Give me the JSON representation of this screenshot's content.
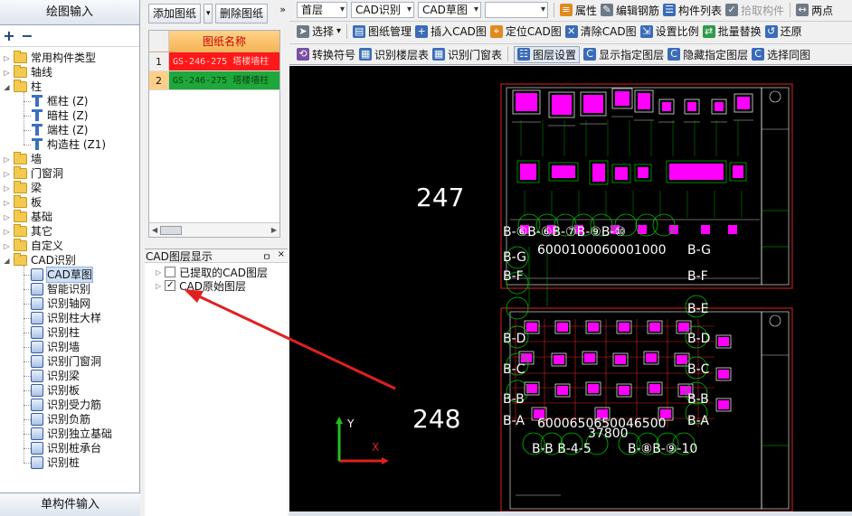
{
  "left": {
    "title": "绘图输入",
    "bottom_title": "单构件输入",
    "tree": [
      {
        "label": "常用构件类型",
        "icon": "folder-icon"
      },
      {
        "label": "轴线",
        "icon": "folder-icon"
      },
      {
        "label": "柱",
        "icon": "folder-icon"
      },
      {
        "label": "框柱 (Z)",
        "icon": "column-icon"
      },
      {
        "label": "暗柱 (Z)",
        "icon": "column-icon"
      },
      {
        "label": "端柱 (Z)",
        "icon": "column-icon"
      },
      {
        "label": "构造柱 (Z1)",
        "icon": "column-icon"
      },
      {
        "label": "墙",
        "icon": "folder-icon"
      },
      {
        "label": "门窗洞",
        "icon": "folder-icon"
      },
      {
        "label": "梁",
        "icon": "folder-icon"
      },
      {
        "label": "板",
        "icon": "folder-icon"
      },
      {
        "label": "基础",
        "icon": "folder-icon"
      },
      {
        "label": "其它",
        "icon": "folder-icon"
      },
      {
        "label": "自定义",
        "icon": "folder-icon"
      },
      {
        "label": "CAD识别",
        "icon": "folder-icon"
      },
      {
        "label": "CAD草图",
        "icon": "cad-sketch-icon"
      },
      {
        "label": "智能识别",
        "icon": "smart-recognize-icon"
      },
      {
        "label": "识别轴网",
        "icon": "recognize-icon"
      },
      {
        "label": "识别柱大样",
        "icon": "recognize-icon"
      },
      {
        "label": "识别柱",
        "icon": "recognize-icon"
      },
      {
        "label": "识别墙",
        "icon": "recognize-icon"
      },
      {
        "label": "识别门窗洞",
        "icon": "recognize-icon"
      },
      {
        "label": "识别梁",
        "icon": "recognize-icon"
      },
      {
        "label": "识别板",
        "icon": "recognize-icon"
      },
      {
        "label": "识别受力筋",
        "icon": "recognize-icon"
      },
      {
        "label": "识别负筋",
        "icon": "recognize-icon"
      },
      {
        "label": "识别独立基础",
        "icon": "recognize-icon"
      },
      {
        "label": "识别桩承台",
        "icon": "recognize-icon"
      },
      {
        "label": "识别桩",
        "icon": "recognize-icon"
      }
    ]
  },
  "drawings": {
    "add_label": "添加图纸",
    "delete_label": "删除图纸",
    "more_label": "»",
    "column_header": "图纸名称",
    "rows": [
      {
        "num": "1",
        "name": "GS-246-275 塔楼墙柱",
        "color": "#ff1818"
      },
      {
        "num": "2",
        "name": "GS-246-275 塔楼墙柱",
        "color": "#1ea83a"
      }
    ]
  },
  "layers": {
    "title": "CAD图层显示",
    "pin_label": "ㅁ",
    "close_label": "×",
    "items": [
      {
        "label": "已提取的CAD图层",
        "checked": "",
        "expand": "▷"
      },
      {
        "label": "CAD原始图层",
        "checked": "✓",
        "expand": "▷"
      }
    ]
  },
  "toolbar": {
    "floor": "首层",
    "mode": "CAD识别",
    "sub_mode": "CAD草图",
    "empty_combo": "",
    "properties": "属性",
    "edit_rebar": "编辑钢筋",
    "component_list": "构件列表",
    "pick_component": "拾取构件",
    "two_points": "两点",
    "select": "选择",
    "drawing_manage": "图纸管理",
    "insert_cad": "插入CAD图",
    "locate_cad": "定位CAD图",
    "clear_cad": "清除CAD图",
    "set_scale": "设置比例",
    "batch_replace": "批量替换",
    "restore": "还原",
    "convert_symbol": "转换符号",
    "recognize_floor_table": "识别楼层表",
    "recognize_door_window_table": "识别门窗表",
    "layer_settings": "图层设置",
    "show_layer": "显示指定图层",
    "hide_layer": "隐藏指定图层",
    "select_same_layer": "选择同图"
  },
  "canvas": {
    "label_top": "247",
    "label_bottom": "248",
    "y_axis": "Y",
    "x_axis": "X",
    "axis_top_row": "B-⑥B-⑥B-⑦B-⑨B-⑩",
    "dims_top": "6000100060001000",
    "grid_f": "B-F",
    "grid_g": "B-G",
    "grid_e": "B-E",
    "grid_d": "B-D",
    "grid_c": "B-C",
    "grid_b": "B-B",
    "grid_a": "B-A",
    "dims_bottom": "6000650650046500",
    "dim_total": "37800",
    "axis_bottom_row": "B-B B-4-5",
    "axis_bottom_row2": "B-⑧B-⑨-10",
    "colors": {
      "frame": "#e02020",
      "magenta": "#ff00ff",
      "green": "#00c000",
      "white": "#ffffff"
    }
  },
  "annotation": {
    "arrow_color": "#e02020"
  }
}
